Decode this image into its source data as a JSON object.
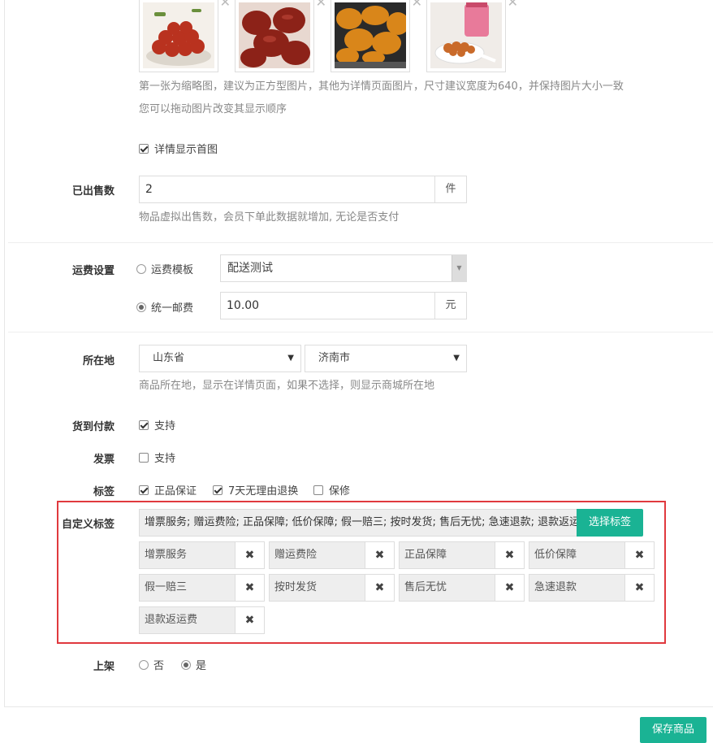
{
  "images": {
    "remove_glyph": "✕",
    "help_line1": "第一张为缩略图，建议为正方型图片，其他为详情页面图片，尺寸建议宽度为640，并保持图片大小一致",
    "help_line2": "您可以拖动图片改变其显示顺序",
    "show_first": {
      "label": "详情显示首图",
      "checked": true
    },
    "items": [
      {
        "name": "red-fruit-bowl-image"
      },
      {
        "name": "dried-red-fruit-image"
      },
      {
        "name": "dried-apricot-image"
      },
      {
        "name": "peanut-jar-image"
      }
    ]
  },
  "sold": {
    "label": "已出售数",
    "value": "2",
    "unit": "件",
    "help": "物品虚拟出售数，会员下单此数据就增加, 无论是否支付"
  },
  "shipping": {
    "label": "运费设置",
    "template_label": "运费模板",
    "template_value": "配送测试",
    "template_selected": false,
    "uniform_label": "统一邮费",
    "uniform_value": "10.00",
    "uniform_unit": "元",
    "uniform_selected": true
  },
  "location": {
    "label": "所在地",
    "province": "山东省",
    "city": "济南市",
    "help": "商品所在地，显示在详情页面，如果不选择，则显示商城所在地"
  },
  "cod": {
    "label": "货到付款",
    "option": "支持",
    "checked": true
  },
  "invoice": {
    "label": "发票",
    "option": "支持",
    "checked": false
  },
  "tags": {
    "label": "标签",
    "options": [
      {
        "label": "正品保证",
        "checked": true
      },
      {
        "label": "7天无理由退换",
        "checked": true
      },
      {
        "label": "保修",
        "checked": false
      }
    ]
  },
  "custom_tags": {
    "label": "自定义标签",
    "summary": "增票服务; 赠运费险; 正品保障; 低价保障; 假一赔三; 按时发货; 售后无忧; 急速退款; 退款返运费",
    "select_button": "选择标签",
    "remove_glyph": "✖",
    "items": [
      "增票服务",
      "赠运费险",
      "正品保障",
      "低价保障",
      "假一赔三",
      "按时发货",
      "售后无忧",
      "急速退款",
      "退款返运费"
    ],
    "highlight_color": "#e0393e"
  },
  "on_shelf": {
    "label": "上架",
    "no": "否",
    "yes": "是",
    "selected": "yes"
  },
  "save_button": "保存商品",
  "colors": {
    "accent": "#1ab394"
  }
}
